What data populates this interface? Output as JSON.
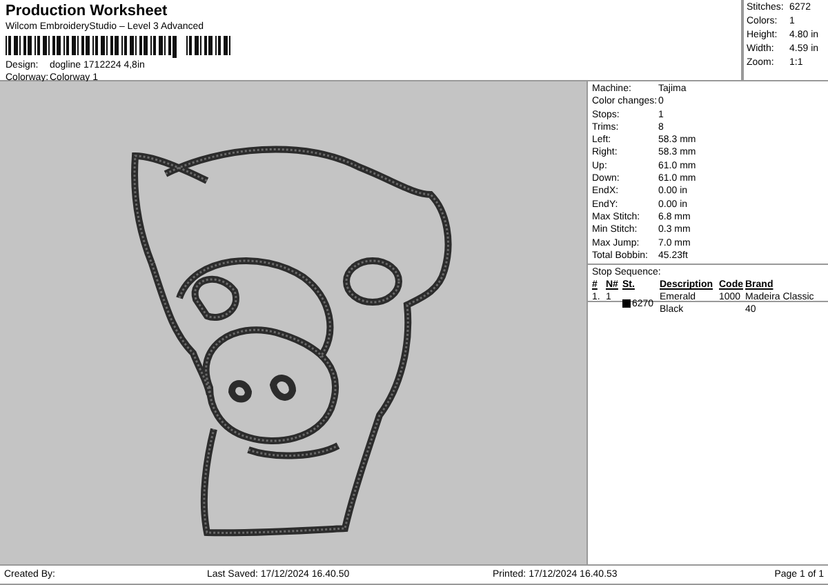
{
  "header": {
    "title": "Production Worksheet",
    "subtitle": "Wilcom EmbroideryStudio – Level 3 Advanced",
    "fields": [
      {
        "label": "Design:",
        "value": "dogline 1712224 4,8in"
      },
      {
        "label": "Colorway:",
        "value": "Colorway 1"
      }
    ]
  },
  "summary": [
    {
      "label": "Stitches:",
      "value": "6272"
    },
    {
      "label": "Colors:",
      "value": "1"
    },
    {
      "label": "Height:",
      "value": "4.80 in"
    },
    {
      "label": "Width:",
      "value": "4.59 in"
    },
    {
      "label": "Zoom:",
      "value": "1:1"
    }
  ],
  "details": [
    {
      "label": "Machine:",
      "value": "Tajima"
    },
    {
      "label": "Color changes:",
      "value": "0"
    },
    {
      "label": "Stops:",
      "value": "1"
    },
    {
      "label": "Trims:",
      "value": "8"
    },
    {
      "label": "Left:",
      "value": "58.3 mm"
    },
    {
      "label": "Right:",
      "value": "58.3 mm"
    },
    {
      "label": "Up:",
      "value": "61.0 mm"
    },
    {
      "label": "Down:",
      "value": "61.0 mm"
    },
    {
      "label": "EndX:",
      "value": "0.00 in"
    },
    {
      "label": "EndY:",
      "value": "0.00 in"
    },
    {
      "label": "Max Stitch:",
      "value": "6.8 mm"
    },
    {
      "label": "Min Stitch:",
      "value": "0.3 mm"
    },
    {
      "label": "Max Jump:",
      "value": "7.0 mm"
    },
    {
      "label": "Total Bobbin:",
      "value": "45.23ft"
    }
  ],
  "stop_sequence": {
    "title": "Stop Sequence:",
    "columns": [
      "#",
      "N#",
      "St.",
      "Description",
      "Code",
      "Brand"
    ],
    "rows": [
      {
        "index": "1.",
        "number": "1",
        "color": "#000000",
        "stitches": "6270",
        "description": "Emerald Black",
        "code": "1000",
        "brand": "Madeira Classic 40"
      }
    ]
  },
  "footer": {
    "created_by": "Created By:",
    "last_saved": "Last Saved: 17/12/2024 16.40.50",
    "printed": "Printed: 17/12/2024 16.40.53",
    "page": "Page 1 of 1"
  }
}
